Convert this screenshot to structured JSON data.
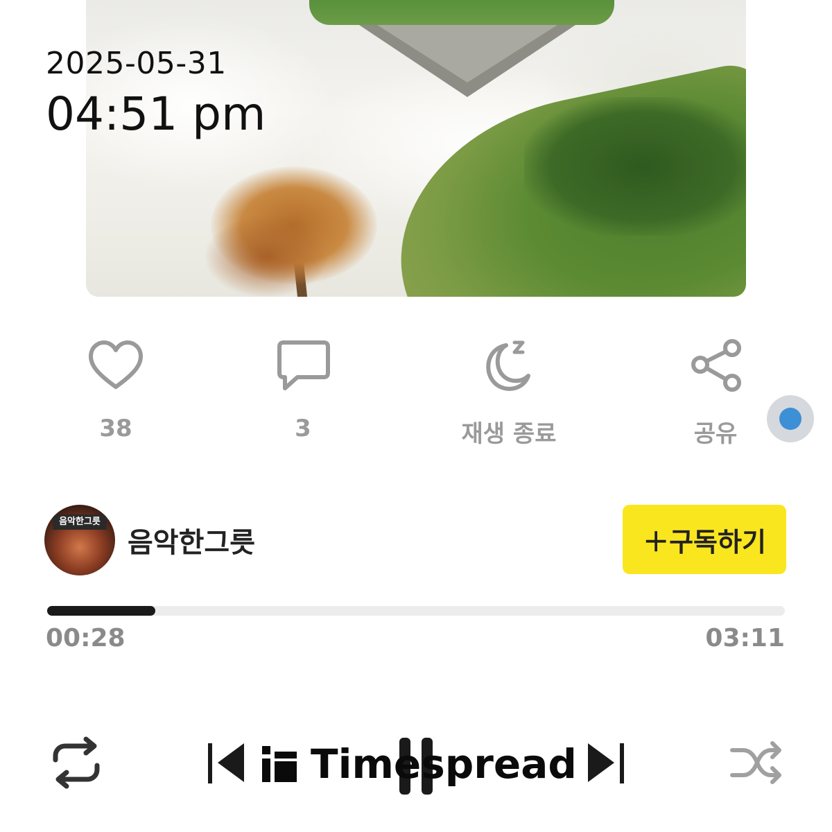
{
  "overlay": {
    "date": "2025-05-31",
    "time": "04:51 pm"
  },
  "actions": [
    {
      "icon": "heart-icon",
      "label": "38"
    },
    {
      "icon": "comment-icon",
      "label": "3"
    },
    {
      "icon": "sleep-timer-icon",
      "label": "재생 종료"
    },
    {
      "icon": "share-icon",
      "label": "공유"
    }
  ],
  "channel": {
    "name": "음악한그릇",
    "avatar_text": "음악한그릇",
    "subscribe_label": "＋구독하기"
  },
  "player": {
    "current_time": "00:28",
    "total_time": "03:11",
    "progress": 0.147
  },
  "watermark": {
    "text": "Timespread"
  },
  "colors": {
    "accent_yellow": "#fae61f",
    "floating_dot": "#3d8fd6",
    "label_gray": "#9a9a9a"
  }
}
